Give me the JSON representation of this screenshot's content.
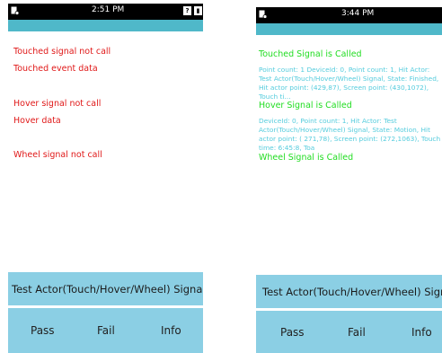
{
  "left": {
    "status": {
      "time": "2:51 PM"
    },
    "labels": {
      "touched_signal": "Touched signal not call",
      "touched_event": "Touched event data",
      "hover_signal": "Hover signal not call",
      "hover_data": "Hover data",
      "wheel_signal": "Wheel signal not call"
    },
    "actor_button": "Test Actor(Touch/Hover/Wheel) Signal",
    "actions": {
      "pass": "Pass",
      "fail": "Fail",
      "info": "Info"
    }
  },
  "right": {
    "status": {
      "time": "3:44 PM"
    },
    "labels": {
      "touched_signal": "Touched Signal is Called",
      "touched_data": "Point count: 1 DeviceId: 0, Point count: 1, Hit Actor: Test Actor(Touch/Hover/Wheel) Signal, State: Finished, Hit actor point: (429,87), Screen point: (430,1072), Touch ti...",
      "hover_signal": "Hover Signal is Called",
      "hover_data": "DeviceId: 0, Point count: 1, Hit Actor: Test Actor(Touch/Hover/Wheel) Signal, State: Motion, Hit actor point: ( 271,78), Screen point: (272,1063), Touch time: 6:45:8, Toa",
      "wheel_signal": "Wheel Signal is Called"
    },
    "actor_button": "Test Actor(Touch/Hover/Wheel) Signal",
    "actions": {
      "pass": "Pass",
      "fail": "Fail",
      "info": "Info"
    }
  },
  "colors": {
    "teal_bar": "#4fb8c9",
    "button_bg": "#8bcfe4",
    "not_called_text": "#e01818",
    "called_text": "#22dd22",
    "data_text": "#55ccdd"
  }
}
